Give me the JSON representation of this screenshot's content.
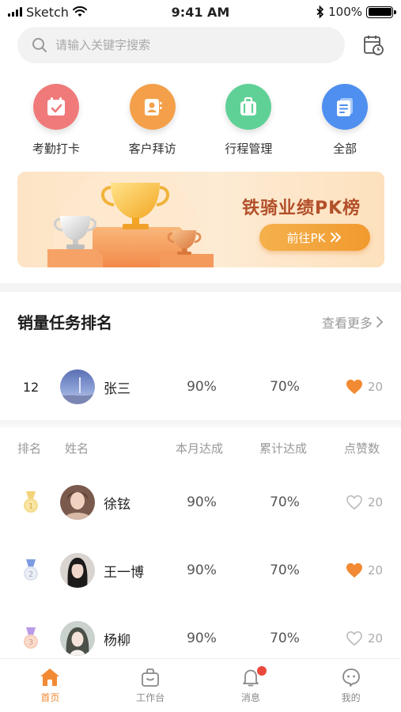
{
  "status_bar": {
    "carrier": "Sketch",
    "time": "9:41 AM",
    "battery": "100%"
  },
  "search": {
    "placeholder": "请输入关键字搜索"
  },
  "quick_entries": [
    {
      "label": "考勤打卡",
      "icon": "calendar-check-icon",
      "color": "#f07a7a"
    },
    {
      "label": "客户拜访",
      "icon": "contact-card-icon",
      "color": "#f4a04a"
    },
    {
      "label": "行程管理",
      "icon": "suitcase-icon",
      "color": "#5fd197"
    },
    {
      "label": "全部",
      "icon": "document-icon",
      "color": "#4f8ff0"
    }
  ],
  "banner": {
    "title": "铁骑业绩PK榜",
    "button": "前往PK"
  },
  "ranking": {
    "title": "销量任务排名",
    "more": "查看更多",
    "my_row": {
      "rank": "12",
      "name": "张三",
      "month": "90%",
      "total": "70%",
      "likes": "20",
      "liked": true
    },
    "columns": [
      "排名",
      "姓名",
      "本月达成",
      "累计达成",
      "点赞数"
    ],
    "rows": [
      {
        "medal": "gold",
        "medal_number": "1",
        "name": "徐铉",
        "month": "90%",
        "total": "70%",
        "likes": "20",
        "liked": false
      },
      {
        "medal": "silver",
        "medal_number": "2",
        "name": "王一博",
        "month": "90%",
        "total": "70%",
        "likes": "20",
        "liked": true
      },
      {
        "medal": "bronze",
        "medal_number": "3",
        "name": "杨柳",
        "month": "90%",
        "total": "70%",
        "likes": "20",
        "liked": false
      }
    ]
  },
  "tabbar": [
    {
      "label": "首页",
      "active": true
    },
    {
      "label": "工作台",
      "active": false
    },
    {
      "label": "消息",
      "active": false,
      "badge": true
    },
    {
      "label": "我的",
      "active": false
    }
  ],
  "colors": {
    "accent": "#f28a33",
    "heart_active": "#f28a33",
    "heart_inactive": "#bbbbbb"
  }
}
